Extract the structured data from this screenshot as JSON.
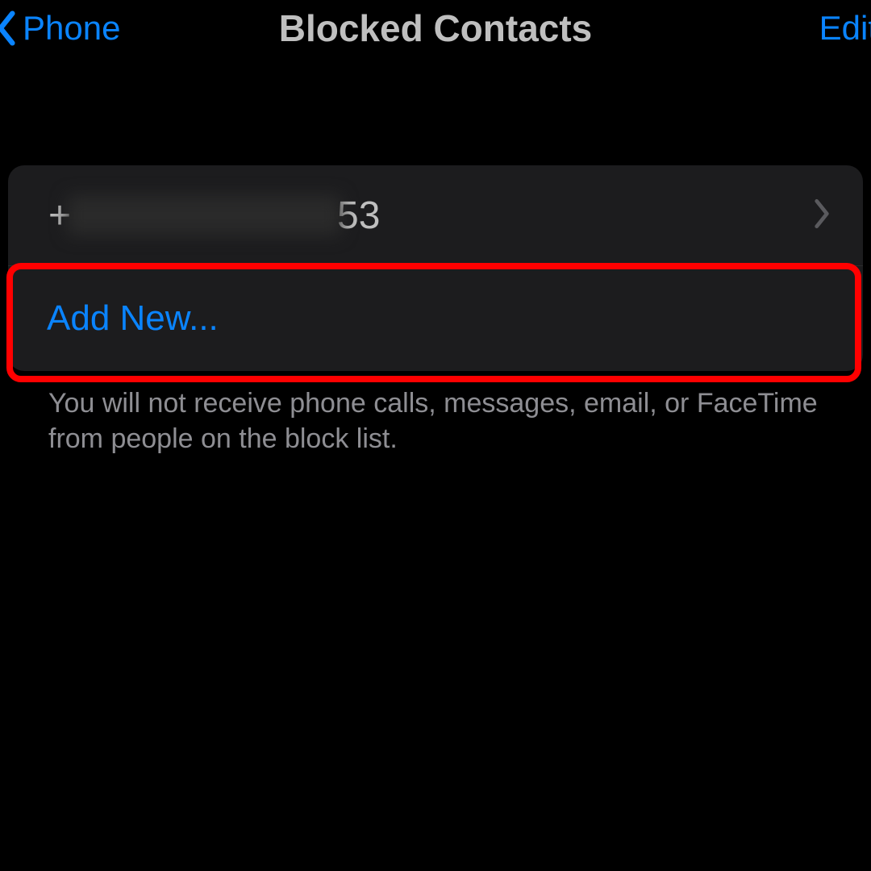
{
  "nav": {
    "back_label": "Phone",
    "title": "Blocked Contacts",
    "edit_label": "Edit"
  },
  "list": {
    "contacts": [
      {
        "prefix": "+",
        "suffix": "53"
      }
    ],
    "add_new_label": "Add New..."
  },
  "footer": {
    "description": "You will not receive phone calls, messages, email, or FaceTime from people on the block list."
  },
  "colors": {
    "accent": "#0a84ff",
    "highlight": "#ff0000",
    "background": "#000000",
    "cell_background": "#1c1c1e"
  }
}
